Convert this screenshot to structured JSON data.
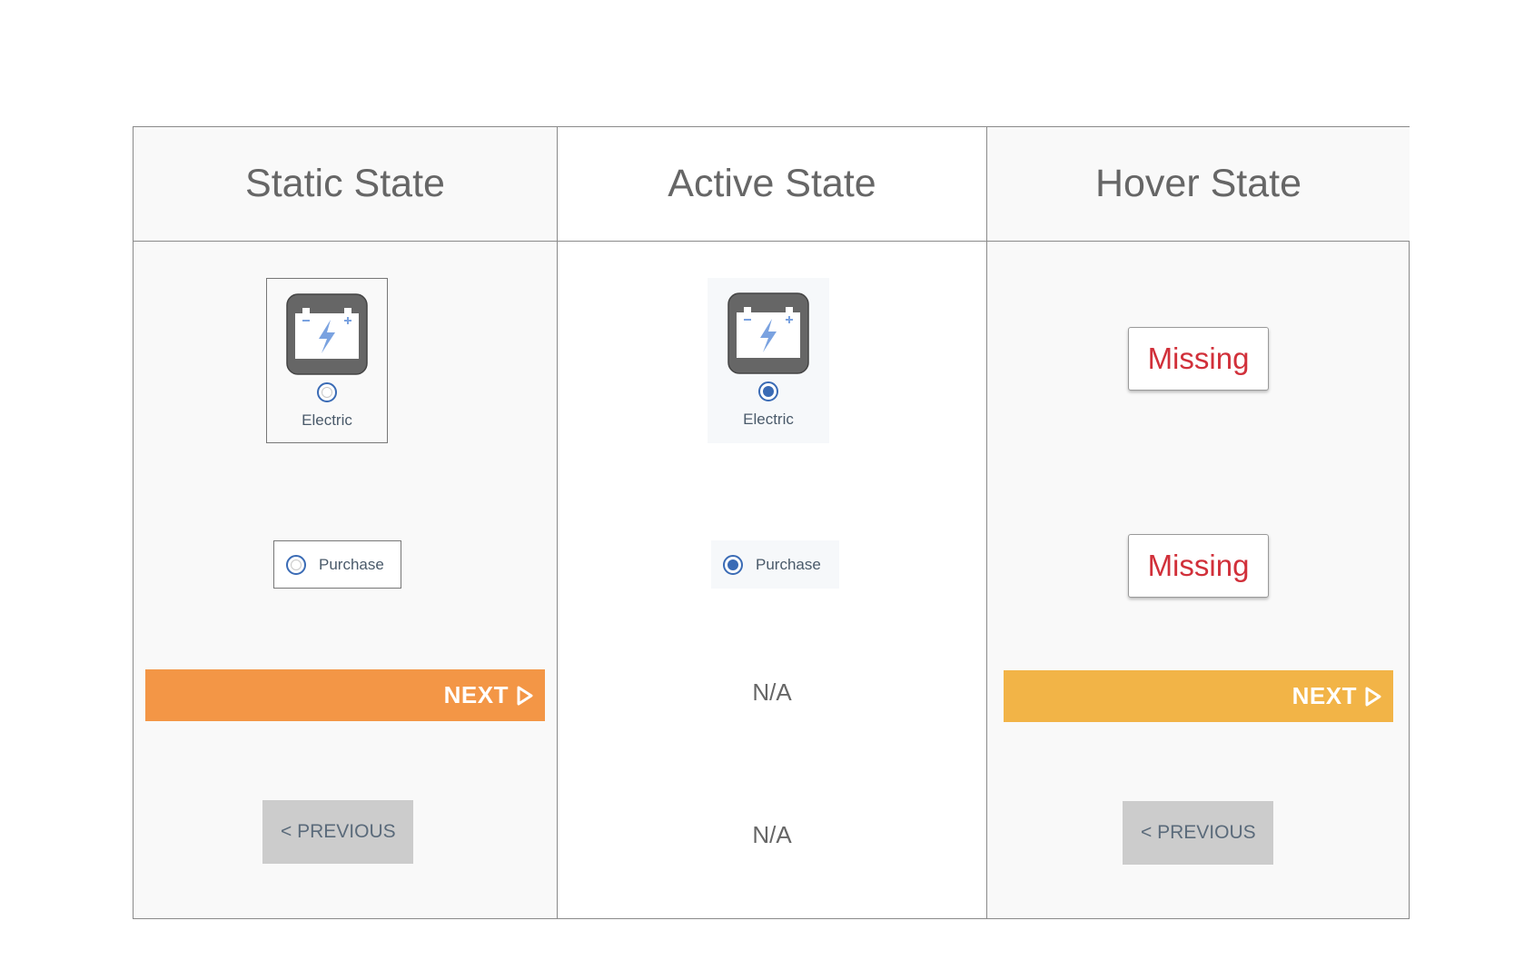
{
  "columns": {
    "static": {
      "title": "Static State"
    },
    "active": {
      "title": "Active State"
    },
    "hover": {
      "title": "Hover State"
    }
  },
  "option_electric": {
    "label": "Electric",
    "icon": "battery-icon"
  },
  "option_purchase": {
    "label": "Purchase"
  },
  "next_button": {
    "label": "NEXT",
    "icon": "play-outline-icon",
    "static_color": "#f39646",
    "hover_color": "#f2b447"
  },
  "previous_button": {
    "label": "< PREVIOUS",
    "color": "#cccccc"
  },
  "active_column": {
    "next_placeholder": "N/A",
    "previous_placeholder": "N/A"
  },
  "hover_column": {
    "electric_placeholder": "Missing",
    "purchase_placeholder": "Missing"
  },
  "colors": {
    "radio_accent": "#3a6bb5",
    "missing_text": "#d1303a",
    "battery_body": "#666666",
    "bolt": "#7aa2e0"
  }
}
